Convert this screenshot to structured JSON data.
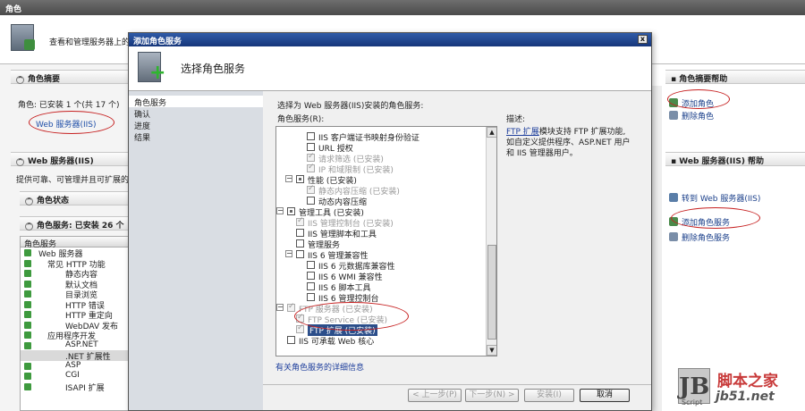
{
  "background": {
    "title": "角色",
    "header_caption": "查看和管理服务器上的角色",
    "role_summary": {
      "title": "角色摘要",
      "roles_line": "角色: 已安装 1 个(共 17 个)",
      "web_role": "Web 服务器(IIS)"
    },
    "web_section": {
      "title": "Web 服务器(IIS)",
      "desc": "提供可靠、可管理并且可扩展的",
      "role_status": "角色状态",
      "role_services": "角色服务: 已安装 26 个"
    },
    "roles_list": {
      "header": "角色服务",
      "rows": [
        "Web 服务器",
        "常见 HTTP 功能",
        "静态内容",
        "默认文档",
        "目录浏览",
        "HTTP 错误",
        "HTTP 重定向",
        "WebDAV 发布",
        "应用程序开发",
        "ASP.NET",
        ".NET 扩展性",
        "ASP",
        "CGI",
        "ISAPI 扩展"
      ]
    },
    "actions": {
      "summary_help": "角色摘要帮助",
      "add_role": "添加角色",
      "remove_role": "删除角色",
      "iis_help": "Web 服务器(IIS) 帮助",
      "goto_iis": "转到 Web 服务器(IIS)",
      "add_service": "添加角色服务",
      "remove_service": "删除角色服务"
    }
  },
  "dialog": {
    "title": "添加角色服务",
    "close": "x",
    "banner_title": "选择角色服务",
    "nav": [
      "角色服务",
      "确认",
      "进度",
      "结果"
    ],
    "instruction": "选择为 Web 服务器(IIS)安装的角色服务:",
    "tree_label": "角色服务(R):",
    "tree": [
      {
        "label": "IIS 客户端证书映射身份验证",
        "installed": false
      },
      {
        "label": "URL 授权",
        "installed": false
      },
      {
        "label": "请求筛选  (已安装)",
        "installed": true
      },
      {
        "label": "IP 和域限制  (已安装)",
        "installed": true
      },
      {
        "label": "性能  (已安装)",
        "installed": true
      },
      {
        "label": "静态内容压缩  (已安装)",
        "installed": true
      },
      {
        "label": "动态内容压缩",
        "installed": false
      },
      {
        "label": "管理工具  (已安装)",
        "installed": true
      },
      {
        "label": "IIS 管理控制台  (已安装)",
        "installed": true
      },
      {
        "label": "IIS 管理脚本和工具",
        "installed": false
      },
      {
        "label": "管理服务",
        "installed": false
      },
      {
        "label": "IIS 6 管理兼容性",
        "installed": false
      },
      {
        "label": "IIS 6 元数据库兼容性",
        "installed": false
      },
      {
        "label": "IIS 6 WMI 兼容性",
        "installed": false
      },
      {
        "label": "IIS 6 脚本工具",
        "installed": false
      },
      {
        "label": "IIS 6 管理控制台",
        "installed": false
      },
      {
        "label": "FTP 服务器  (已安装)",
        "installed": true
      },
      {
        "label": "FTP Service  (已安装)",
        "installed": true
      },
      {
        "label": "FTP 扩展  (已安装)",
        "installed": true
      },
      {
        "label": "IIS 可承载 Web 核心",
        "installed": false
      }
    ],
    "description_label": "描述:",
    "description_link": "FTP 扩展",
    "description_text_1": "模块支持 FTP 扩展功能,",
    "description_text_2": "如自定义提供程序、ASP.NET 用户",
    "description_text_3": "和 IIS 管理器用户。",
    "more_info": "有关角色服务的详细信息",
    "buttons": {
      "prev": "< 上一步(P)",
      "next": "下一步(N) >",
      "install": "安装(I)",
      "cancel": "取消"
    }
  },
  "watermark": {
    "logo": "JB",
    "script": "Script",
    "name": "脚本之家",
    "url": "jb51.net"
  }
}
